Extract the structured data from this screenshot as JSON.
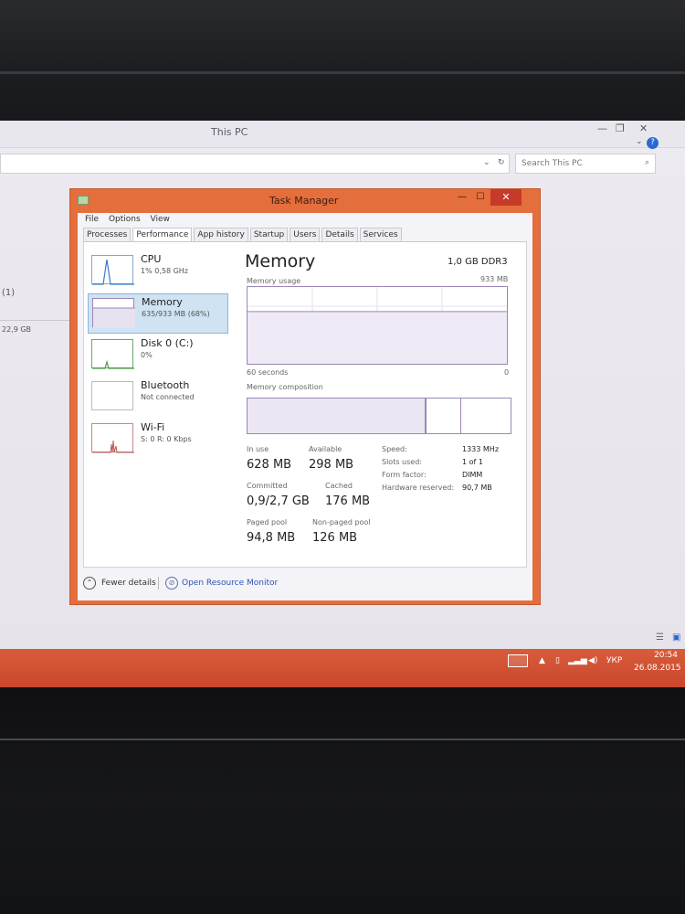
{
  "explorer": {
    "title": "This PC",
    "search_placeholder": "Search This PC",
    "left_pane": [
      "(1)",
      "22,9 GB"
    ]
  },
  "task_manager": {
    "title": "Task Manager",
    "menu": [
      "File",
      "Options",
      "View"
    ],
    "tabs": [
      "Processes",
      "Performance",
      "App history",
      "Startup",
      "Users",
      "Details",
      "Services"
    ],
    "active_tab": "Performance",
    "sidebar": [
      {
        "title": "CPU",
        "sub": "1% 0,58 GHz"
      },
      {
        "title": "Memory",
        "sub": "635/933 MB (68%)"
      },
      {
        "title": "Disk 0 (C:)",
        "sub": "0%"
      },
      {
        "title": "Bluetooth",
        "sub": "Not connected"
      },
      {
        "title": "Wi-Fi",
        "sub": "S: 0 R: 0 Kbps"
      }
    ],
    "main": {
      "title": "Memory",
      "type": "1,0 GB DDR3",
      "usage_label": "Memory usage",
      "usage_max": "933 MB",
      "time_label": "60 seconds",
      "zero_label": "0",
      "composition_label": "Memory composition",
      "usage_fraction": 0.68,
      "stats": {
        "in_use_label": "In use",
        "in_use": "628 MB",
        "available_label": "Available",
        "available": "298 MB",
        "committed_label": "Committed",
        "committed": "0,9/2,7 GB",
        "cached_label": "Cached",
        "cached": "176 MB",
        "paged_label": "Paged pool",
        "paged": "94,8 MB",
        "nonpaged_label": "Non-paged pool",
        "nonpaged": "126 MB"
      },
      "specs": {
        "speed_label": "Speed:",
        "speed": "1333 MHz",
        "slots_label": "Slots used:",
        "slots": "1 of 1",
        "form_label": "Form factor:",
        "form": "DIMM",
        "reserved_label": "Hardware reserved:",
        "reserved": "90,7 MB"
      }
    },
    "footer": {
      "fewer_details": "Fewer details",
      "resource_monitor": "Open Resource Monitor"
    }
  },
  "taskbar": {
    "language": "УКР",
    "time": "20:54",
    "date": "26.08.2015"
  },
  "colors": {
    "accent": "#e46e3c",
    "taskbar": "#c9472e",
    "memory_graph": "#9b86b8"
  }
}
